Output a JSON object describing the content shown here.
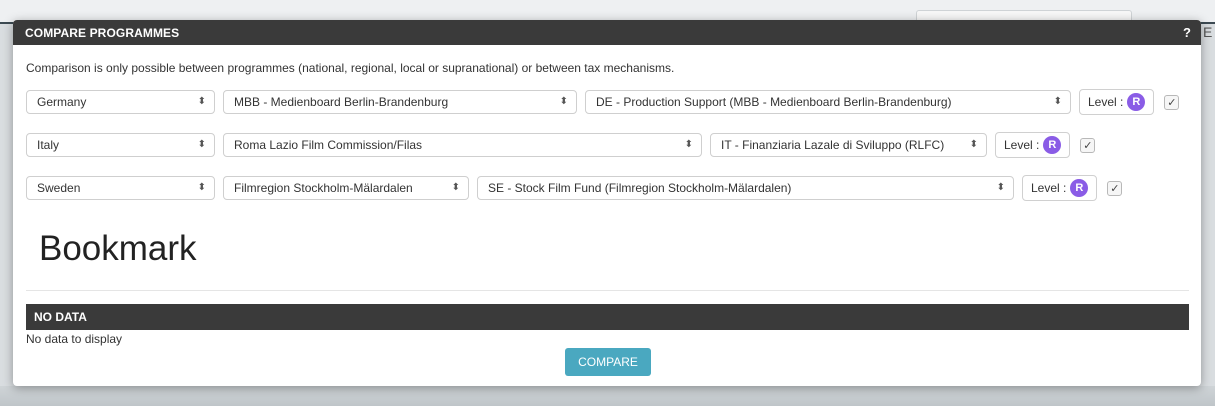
{
  "modal": {
    "title": "COMPARE PROGRAMMES",
    "help": "?",
    "intro": "Comparison is only possible between programmes (national, regional, local or supranational) or between tax mechanisms."
  },
  "rows": [
    {
      "country": "Germany",
      "fund": "MBB - Medienboard Berlin-Brandenburg",
      "programme": "DE - Production Support (MBB - Medienboard Berlin-Brandenburg)",
      "level_label": "Level :",
      "level_badge": "R",
      "checked": "✓"
    },
    {
      "country": "Italy",
      "fund": "Roma Lazio Film Commission/Filas",
      "programme": "IT - Finanziaria Lazale di Sviluppo (RLFC)",
      "level_label": "Level :",
      "level_badge": "R",
      "checked": "✓"
    },
    {
      "country": "Sweden",
      "fund": "Filmregion Stockholm-Mälardalen",
      "programme": "SE - Stock Film Fund (Filmregion Stockholm-Mälardalen)",
      "level_label": "Level :",
      "level_badge": "R",
      "checked": "✓"
    }
  ],
  "bookmark": {
    "heading": "Bookmark"
  },
  "results": {
    "bar": "NO DATA",
    "message": "No data to display"
  },
  "actions": {
    "compare": "COMPARE"
  },
  "background": {
    "letter": "E"
  },
  "colors": {
    "header": "#3a3a3a",
    "accent_button": "#4aa8c0",
    "level_badge": "#8a5ce6"
  }
}
